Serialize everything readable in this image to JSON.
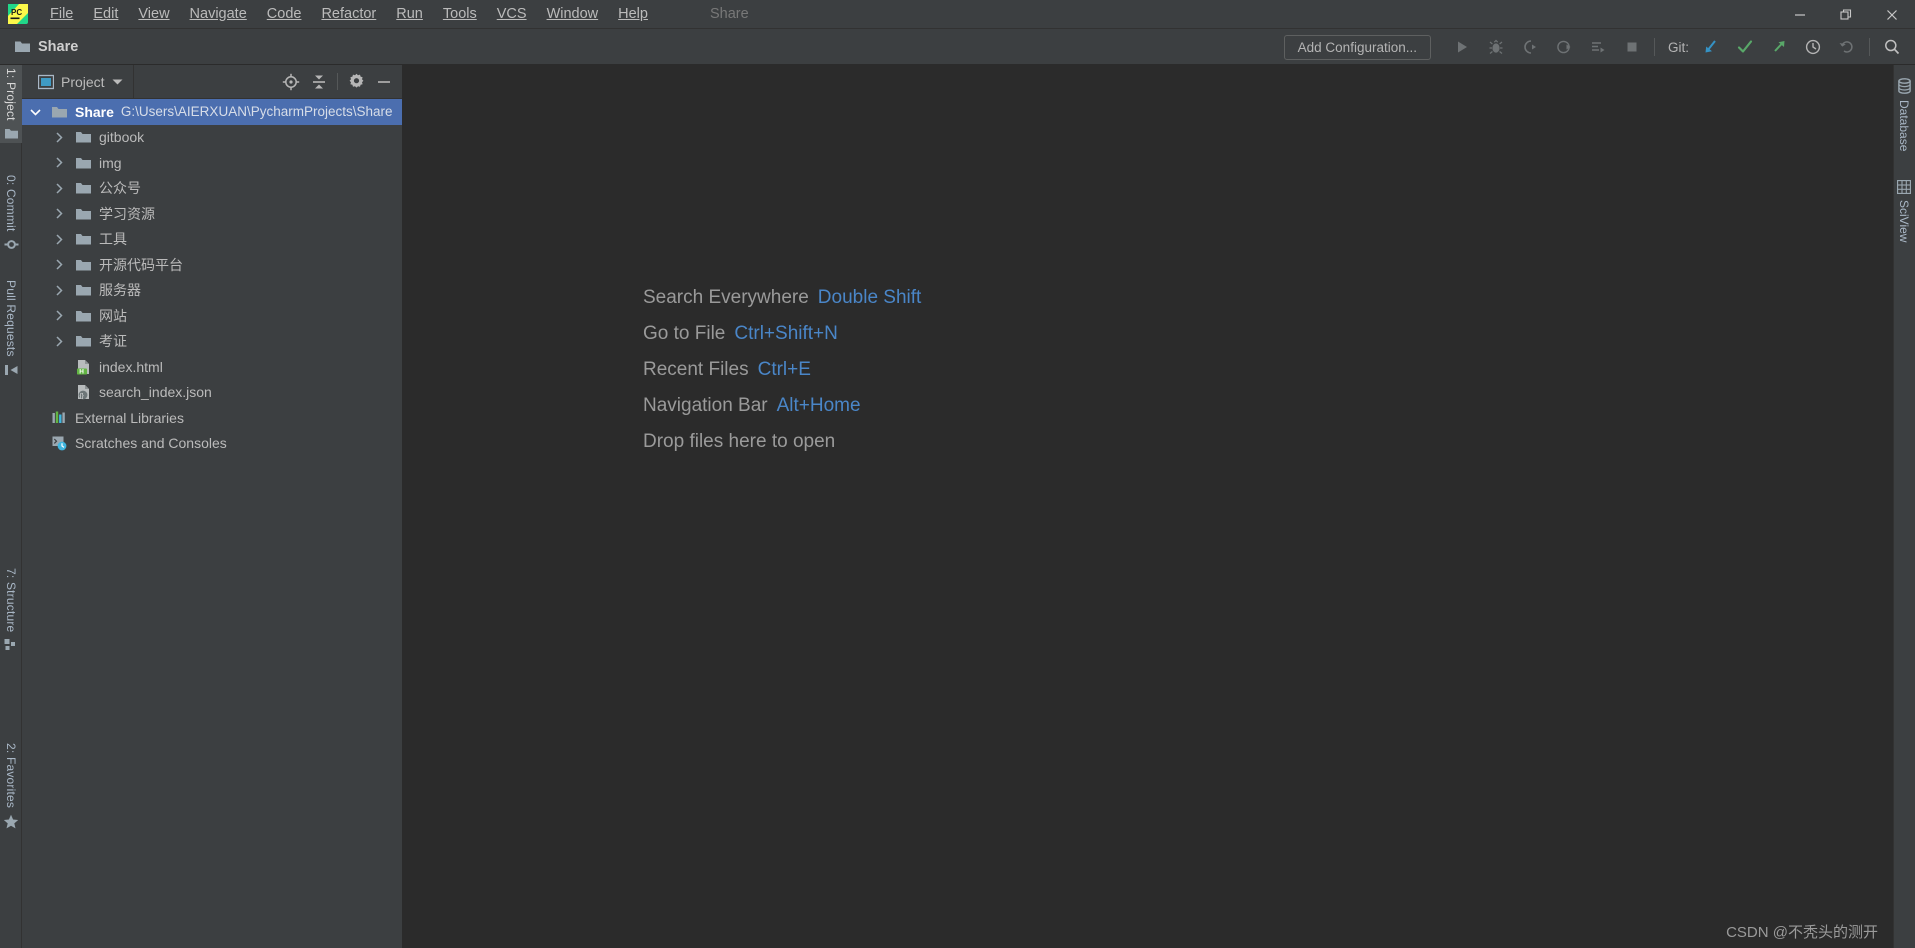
{
  "window": {
    "title": "Share",
    "controls": {
      "minimize": "minimize-icon",
      "maximize": "maximize-icon",
      "close": "close-icon"
    }
  },
  "menubar": {
    "items": [
      {
        "label": "File",
        "mnemonic": "F"
      },
      {
        "label": "Edit",
        "mnemonic": "E"
      },
      {
        "label": "View",
        "mnemonic": "V"
      },
      {
        "label": "Navigate",
        "mnemonic": "N"
      },
      {
        "label": "Code",
        "mnemonic": "C"
      },
      {
        "label": "Refactor",
        "mnemonic": "R"
      },
      {
        "label": "Run",
        "mnemonic": "u"
      },
      {
        "label": "Tools",
        "mnemonic": "T"
      },
      {
        "label": "VCS",
        "mnemonic": "S"
      },
      {
        "label": "Window",
        "mnemonic": "W"
      },
      {
        "label": "Help",
        "mnemonic": "H"
      }
    ],
    "project_name": "Share"
  },
  "toolbar": {
    "breadcrumb": "Share",
    "add_configuration_label": "Add Configuration...",
    "git_label": "Git:",
    "buttons": [
      {
        "name": "run-button",
        "icon": "play-icon"
      },
      {
        "name": "debug-button",
        "icon": "bug-icon"
      },
      {
        "name": "run-coverage-button",
        "icon": "coverage-icon"
      },
      {
        "name": "profile-button",
        "icon": "profile-icon"
      },
      {
        "name": "run-with-console-button",
        "icon": "console-run-icon"
      },
      {
        "name": "stop-button",
        "icon": "stop-icon"
      }
    ],
    "git_buttons": [
      {
        "name": "git-update-project-button",
        "icon": "update-arrow-icon",
        "color": "#3592c4"
      },
      {
        "name": "git-commit-button",
        "icon": "check-icon",
        "color": "#59a869"
      },
      {
        "name": "git-push-button",
        "icon": "push-arrow-icon",
        "color": "#59a869"
      },
      {
        "name": "git-history-button",
        "icon": "clock-icon"
      },
      {
        "name": "git-rollback-button",
        "icon": "rollback-icon"
      }
    ],
    "search_button": {
      "name": "search-everywhere-button",
      "icon": "search-icon"
    }
  },
  "left_stripe": {
    "top_tabs": [
      {
        "label": "1: Project",
        "icon": "folder-icon",
        "active": true
      },
      {
        "label": "0: Commit",
        "icon": "commit-icon",
        "active": false
      },
      {
        "label": "Pull Requests",
        "icon": "pull-request-icon",
        "active": false
      }
    ],
    "bottom_tabs": [
      {
        "label": "7: Structure",
        "icon": "structure-icon",
        "active": false
      },
      {
        "label": "2: Favorites",
        "icon": "star-icon",
        "active": false
      }
    ]
  },
  "right_stripe": {
    "tabs": [
      {
        "label": "Database",
        "icon": "database-icon"
      },
      {
        "label": "SciView",
        "icon": "grid-icon"
      }
    ]
  },
  "project_panel": {
    "title": "Project",
    "actions": [
      {
        "name": "select-opened-file-button",
        "icon": "locate-icon"
      },
      {
        "name": "collapse-all-button",
        "icon": "collapse-all-icon"
      },
      {
        "name": "settings-button",
        "icon": "gear-icon"
      },
      {
        "name": "hide-button",
        "icon": "minimize-icon"
      }
    ],
    "tree": [
      {
        "name": "Share",
        "path": "G:\\Users\\AIERXUAN\\PycharmProjects\\Share",
        "icon": "folder-icon",
        "indent": 0,
        "twisty": "expanded",
        "selected": true
      },
      {
        "name": "gitbook",
        "path": "",
        "icon": "folder-icon",
        "indent": 1,
        "twisty": "collapsed",
        "selected": false
      },
      {
        "name": "img",
        "path": "",
        "icon": "folder-icon",
        "indent": 1,
        "twisty": "collapsed",
        "selected": false
      },
      {
        "name": "公众号",
        "path": "",
        "icon": "folder-icon",
        "indent": 1,
        "twisty": "collapsed",
        "selected": false
      },
      {
        "name": "学习资源",
        "path": "",
        "icon": "folder-icon",
        "indent": 1,
        "twisty": "collapsed",
        "selected": false
      },
      {
        "name": "工具",
        "path": "",
        "icon": "folder-icon",
        "indent": 1,
        "twisty": "collapsed",
        "selected": false
      },
      {
        "name": "开源代码平台",
        "path": "",
        "icon": "folder-icon",
        "indent": 1,
        "twisty": "collapsed",
        "selected": false
      },
      {
        "name": "服务器",
        "path": "",
        "icon": "folder-icon",
        "indent": 1,
        "twisty": "collapsed",
        "selected": false
      },
      {
        "name": "网站",
        "path": "",
        "icon": "folder-icon",
        "indent": 1,
        "twisty": "collapsed",
        "selected": false
      },
      {
        "name": "考证",
        "path": "",
        "icon": "folder-icon",
        "indent": 1,
        "twisty": "collapsed",
        "selected": false
      },
      {
        "name": "index.html",
        "path": "",
        "icon": "html-file-icon",
        "indent": 1,
        "twisty": "none",
        "selected": false
      },
      {
        "name": "search_index.json",
        "path": "",
        "icon": "json-file-icon",
        "indent": 1,
        "twisty": "none",
        "selected": false
      },
      {
        "name": "External Libraries",
        "path": "",
        "icon": "libraries-icon",
        "indent": 0,
        "twisty": "none",
        "selected": false
      },
      {
        "name": "Scratches and Consoles",
        "path": "",
        "icon": "scratches-icon",
        "indent": 0,
        "twisty": "none",
        "selected": false
      }
    ]
  },
  "editor": {
    "hints": [
      {
        "action": "Search Everywhere",
        "shortcut": "Double Shift"
      },
      {
        "action": "Go to File",
        "shortcut": "Ctrl+Shift+N"
      },
      {
        "action": "Recent Files",
        "shortcut": "Ctrl+E"
      },
      {
        "action": "Navigation Bar",
        "shortcut": "Alt+Home"
      },
      {
        "action": "Drop files here to open",
        "shortcut": ""
      }
    ],
    "watermark": "CSDN @不秃头的测开"
  },
  "colors": {
    "background": "#3c3f41",
    "editor_background": "#2b2b2b",
    "selection": "#4b6eaf",
    "accent_blue": "#4a86c8",
    "green": "#59a869",
    "text": "#bbbbbb"
  }
}
